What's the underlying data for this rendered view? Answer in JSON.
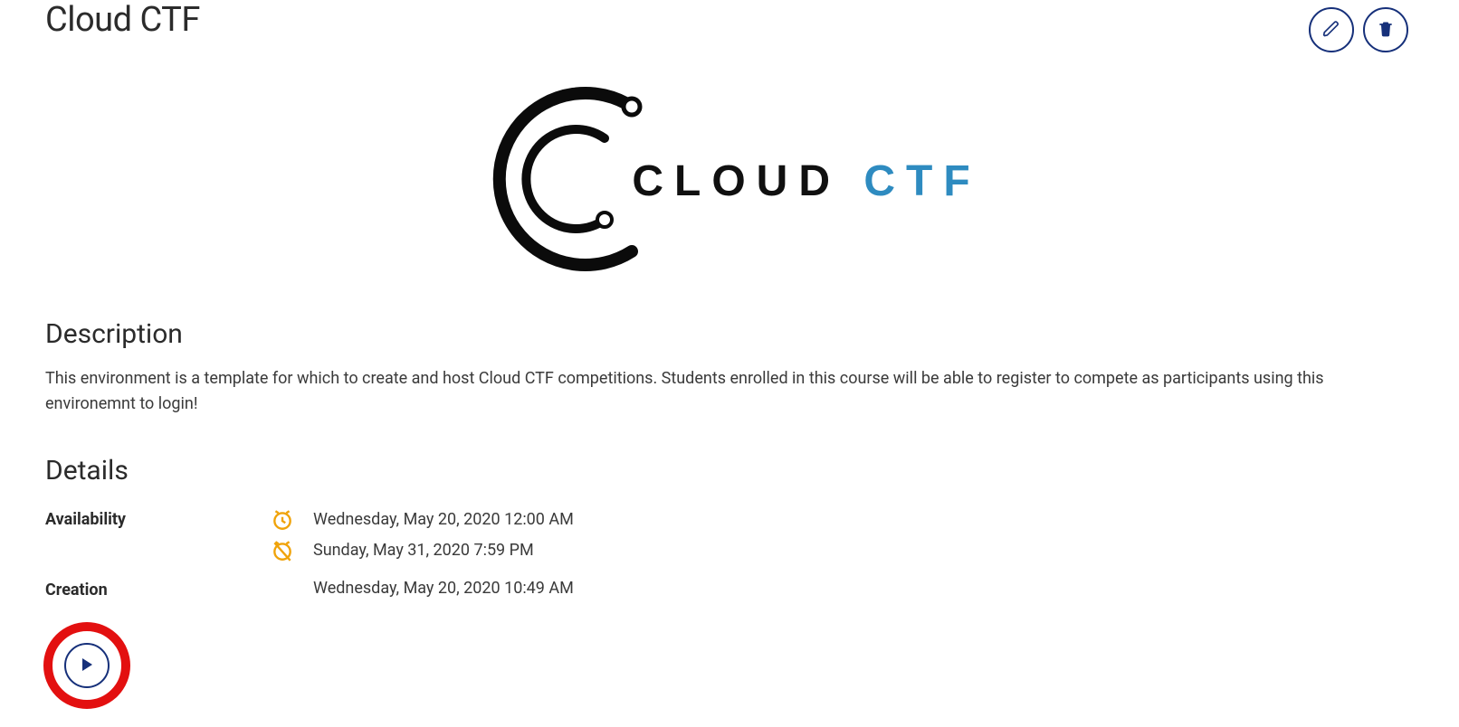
{
  "header": {
    "title": "Cloud CTF"
  },
  "logo": {
    "word1": "CLOUD",
    "word2": "CTF"
  },
  "description": {
    "heading": "Description",
    "body": "This environment is a template for which to create and host Cloud CTF competitions. Students enrolled in this course will be able to register to compete as participants using this environemnt to login!"
  },
  "details": {
    "heading": "Details",
    "availability_label": "Availability",
    "availability_start": "Wednesday, May 20, 2020 12:00 AM",
    "availability_end": "Sunday, May 31, 2020 7:59 PM",
    "creation_label": "Creation",
    "creation_value": "Wednesday, May 20, 2020 10:49 AM"
  },
  "colors": {
    "accent_navy": "#16307a",
    "highlight_red": "#e31010",
    "clock_amber": "#f0a30a",
    "logo_blue": "#2e8bc0"
  }
}
